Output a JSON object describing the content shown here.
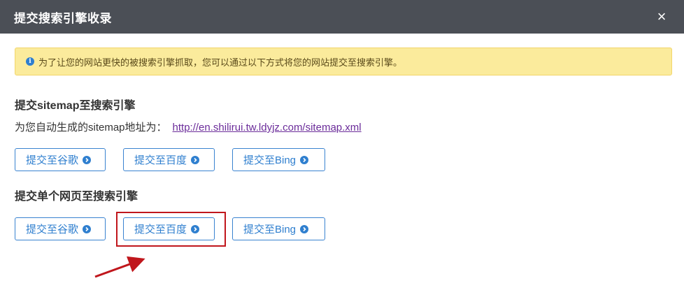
{
  "header": {
    "title": "提交搜索引擎收录",
    "close_symbol": "×"
  },
  "alert": {
    "icon": "info-icon",
    "text": "为了让您的网站更快的被搜索引擎抓取，您可以通过以下方式将您的网站提交至搜索引擎。"
  },
  "sitemap_section": {
    "title": "提交sitemap至搜索引擎",
    "label": "为您自动生成的sitemap地址为：",
    "url": "http://en.shilirui.tw.ldyjz.com/sitemap.xml",
    "buttons": {
      "google": "提交至谷歌",
      "baidu": "提交至百度",
      "bing": "提交至Bing"
    }
  },
  "page_section": {
    "title": "提交单个网页至搜索引擎",
    "buttons": {
      "google": "提交至谷歌",
      "baidu": "提交至百度",
      "bing": "提交至Bing"
    }
  },
  "colors": {
    "header_bg": "#4b4f56",
    "alert_bg": "#fbeb9c",
    "button_accent": "#2f7fcf",
    "link": "#6b2c9a",
    "annotation": "#c0161c"
  }
}
